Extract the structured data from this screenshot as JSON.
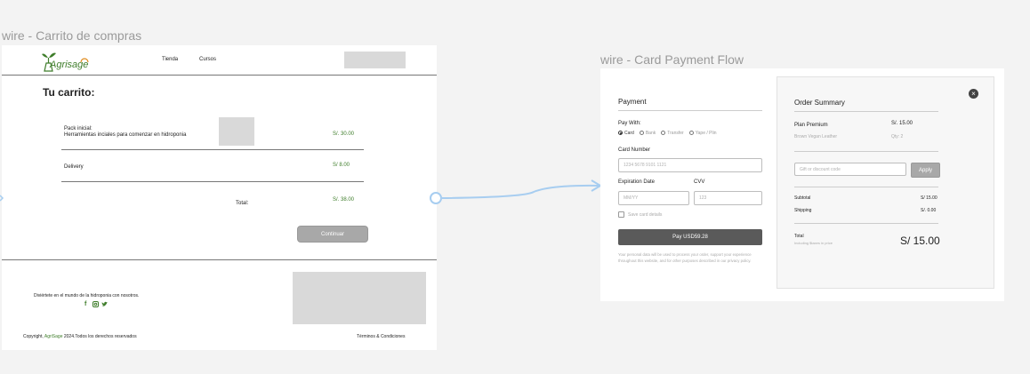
{
  "cart_frame": {
    "label": "wire - Carrito de compras",
    "logo": {
      "text": "Agrisage"
    },
    "nav": [
      "Tienda",
      "Cursos"
    ],
    "title": "Tu carrito:",
    "items": [
      {
        "name": "Pack inicial:",
        "desc": "Herramientas inciales para comenzar en hidroponia",
        "price": "S/. 30.00"
      },
      {
        "name": "Delivery",
        "price": "S/ 8.00"
      }
    ],
    "total_label": "Total:",
    "total_value": "S/. 38.00",
    "continue_label": "Continuar",
    "footer": {
      "tagline": "Diviértete en el mundo de la hidroponia con nosotros.",
      "social_icons": [
        "facebook-icon",
        "instagram-icon",
        "twitter-icon"
      ],
      "copyright_prefix": "Copyright, ",
      "copyright_brand": "AgriSage",
      "copyright_suffix": " 2024.Todos los derechos reservados",
      "terms": "Términos & Condiciones"
    },
    "colors": {
      "brand_green": "#3e7d2a"
    }
  },
  "payment_frame": {
    "label": "wire - Card Payment Flow",
    "payment": {
      "title": "Payment",
      "pay_with_label": "Pay With:",
      "methods": [
        "Card",
        "Bank",
        "Transfer",
        "Yape / Plin"
      ],
      "selected_method": "Card",
      "card_number_label": "Card Number",
      "card_number_placeholder": "1234  5678  9101  1121",
      "expiration_label": "Expiration Date",
      "expiration_placeholder": "MM/YY",
      "cvv_label": "CVV",
      "cvv_placeholder": "123",
      "save_card_label": "Save card details",
      "pay_button": "Pay USD59.28",
      "disclaimer": "Your personal data will be used to process your order, support your experience throughout this website, and for other purposes described in our privacy policy."
    },
    "summary": {
      "title": "Order Summary",
      "product_name": "Plan Premium",
      "product_sub": "Brown Vegan Leather",
      "product_price": "S/. 15.00",
      "product_qty": "Qty: 2",
      "discount_placeholder": "Gift or discount code",
      "apply_label": "Apply",
      "subtotal_label": "Subtotal",
      "subtotal_value": "S/ 15.00",
      "shipping_label": "Shipping",
      "shipping_value": "S/. 0.00",
      "total_label": "Total",
      "total_note": "Including $taxes in price",
      "total_value": "S/ 15.00"
    }
  }
}
